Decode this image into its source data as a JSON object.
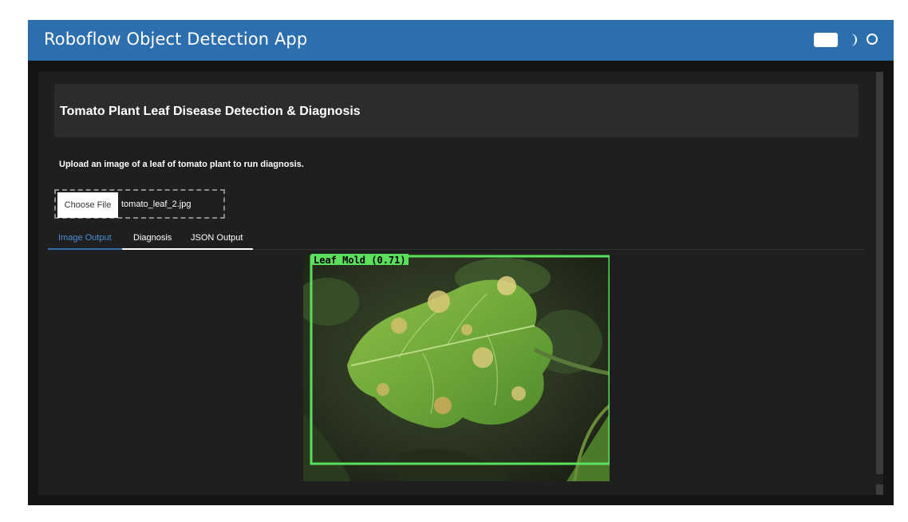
{
  "header": {
    "title": "Roboflow Object Detection App",
    "bg_color": "#2d6fae",
    "theme_icons": [
      "toggle-icon",
      "moon-icon",
      "sun-icon"
    ]
  },
  "card": {
    "heading": "Tomato Plant Leaf Disease Detection & Diagnosis"
  },
  "upload": {
    "description": "Upload an image of a leaf of tomato plant to run diagnosis.",
    "button_label": "Choose File",
    "file_name": "tomato_leaf_2.jpg"
  },
  "tabs": [
    {
      "label": "Image Output",
      "active": true
    },
    {
      "label": "Diagnosis",
      "active": false
    },
    {
      "label": "JSON Output",
      "active": false
    }
  ],
  "accent_color": "#2d6fae",
  "detection": {
    "label": "Leaf Mold (0.71)",
    "box_color": "#5be05b"
  }
}
